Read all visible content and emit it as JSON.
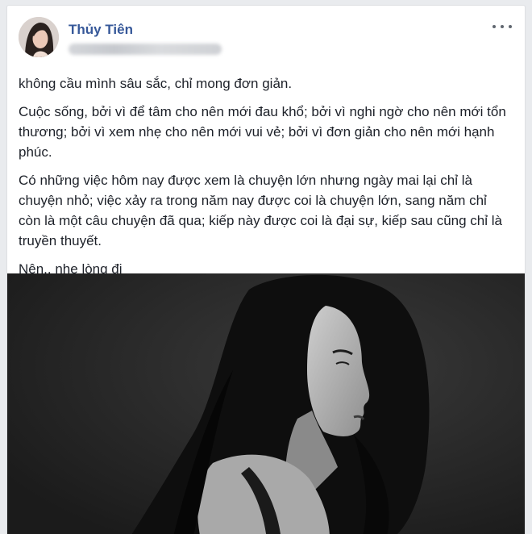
{
  "post": {
    "author": "Thủy Tiên",
    "avatar_icon": "profile-avatar",
    "more_icon": "ellipsis-icon",
    "paragraphs": [
      "không cầu mình sâu sắc, chỉ mong đơn giản.",
      "Cuộc sống, bởi vì để tâm cho nên mới đau khổ; bởi vì nghi ngờ cho nên mới tổn thương; bởi vì xem nhẹ cho nên mới vui vẻ; bởi vì đơn giản cho nên mới hạnh phúc.",
      "Có những việc hôm nay được xem là chuyện lớn nhưng ngày mai lại chỉ là chuyện nhỏ; việc xảy ra trong năm nay được coi là chuyện lớn, sang năm chỉ còn là một câu chuyện đã qua; kiếp này được coi là đại sự, kiếp sau cũng chỉ là truyền thuyết.",
      "Nên.. nhẹ lòng đi"
    ]
  },
  "colors": {
    "author_link": "#365899",
    "body_text": "#1d2129",
    "page_background": "#e9ebee",
    "photo_background": "#232323"
  }
}
